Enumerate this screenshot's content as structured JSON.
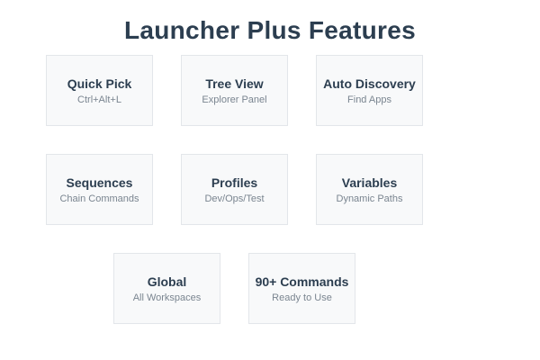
{
  "title": "Launcher Plus Features",
  "features": [
    {
      "name": "Quick Pick",
      "detail": "Ctrl+Alt+L"
    },
    {
      "name": "Tree View",
      "detail": "Explorer Panel"
    },
    {
      "name": "Auto Discovery",
      "detail": "Find Apps"
    },
    {
      "name": "Sequences",
      "detail": "Chain Commands"
    },
    {
      "name": "Profiles",
      "detail": "Dev/Ops/Test"
    },
    {
      "name": "Variables",
      "detail": "Dynamic Paths"
    },
    {
      "name": "Global",
      "detail": "All Workspaces"
    },
    {
      "name": "90+ Commands",
      "detail": "Ready to Use"
    }
  ],
  "colors": {
    "title": "#2c3e50",
    "card_background": "#f8f9fa",
    "card_border": "#e3e6ea",
    "subtext": "#7a8590"
  }
}
